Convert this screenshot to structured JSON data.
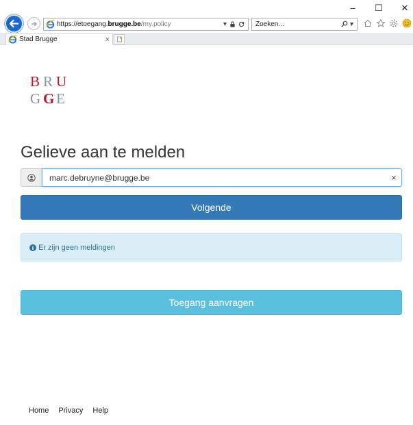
{
  "browser": {
    "window_controls": {
      "minimize": "–",
      "maximize": "☐",
      "close": "✕"
    },
    "address": {
      "scheme": "https://",
      "host_prefix": "etoegang.",
      "host": "brugge.be",
      "path": "/my.policy"
    },
    "search": {
      "placeholder": "Zoeken..."
    },
    "tab": {
      "title": "Stad Brugge",
      "close": "×"
    },
    "icons": [
      "back-arrow-icon",
      "forward-arrow-icon",
      "ie-favicon",
      "lock-icon",
      "refresh-icon",
      "search-icon",
      "home-icon",
      "star-icon",
      "gear-icon",
      "smiley-icon"
    ]
  },
  "logo": {
    "row1": [
      "B",
      "R",
      "U"
    ],
    "row2": [
      "G",
      "G",
      "E"
    ],
    "colors": {
      "red": "#b2182b",
      "blue_grey": "#7f93b0"
    }
  },
  "login": {
    "heading": "Gelieve aan te melden",
    "username_value": "marc.debruyne@brugge.be",
    "clear": "×",
    "next_button": "Volgende",
    "alert": "Er zijn geen meldingen",
    "request_access_button": "Toegang aanvragen"
  },
  "footer": {
    "links": [
      "Home",
      "Privacy",
      "Help"
    ]
  },
  "colors": {
    "primary": "#337ab7",
    "info_button": "#5bc0de",
    "alert_bg": "#d9edf7",
    "alert_text": "#31708f"
  }
}
